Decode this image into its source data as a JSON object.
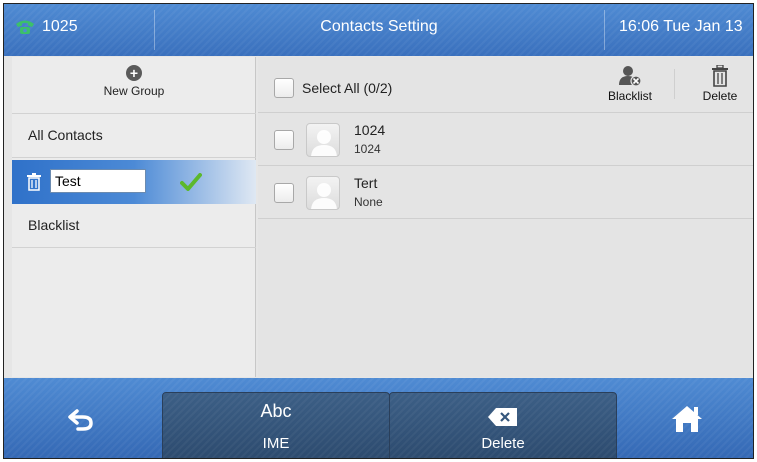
{
  "status_bar": {
    "line_number": "1025",
    "title": "Contacts Setting",
    "time": "16:06 Tue Jan 13"
  },
  "groups": {
    "new_group_label": "New Group",
    "all_contacts_label": "All Contacts",
    "editing_group_value": "Test",
    "blacklist_label": "Blacklist"
  },
  "toolbar": {
    "select_all_label": "Select All (0/2)",
    "blacklist_label": "Blacklist",
    "delete_label": "Delete"
  },
  "contacts": [
    {
      "name": "1024",
      "number": "1024"
    },
    {
      "name": "Tert",
      "number": "None"
    }
  ],
  "softkeys": {
    "ime_big": "Abc",
    "ime_label": "IME",
    "delete_label": "Delete"
  },
  "colors": {
    "header_blue": "#4a84cf",
    "selected_row_blue": "#2f71c9",
    "softkey_dark": "#34567c",
    "check_green": "#5cb82c",
    "phone_green": "#3cc06a"
  }
}
